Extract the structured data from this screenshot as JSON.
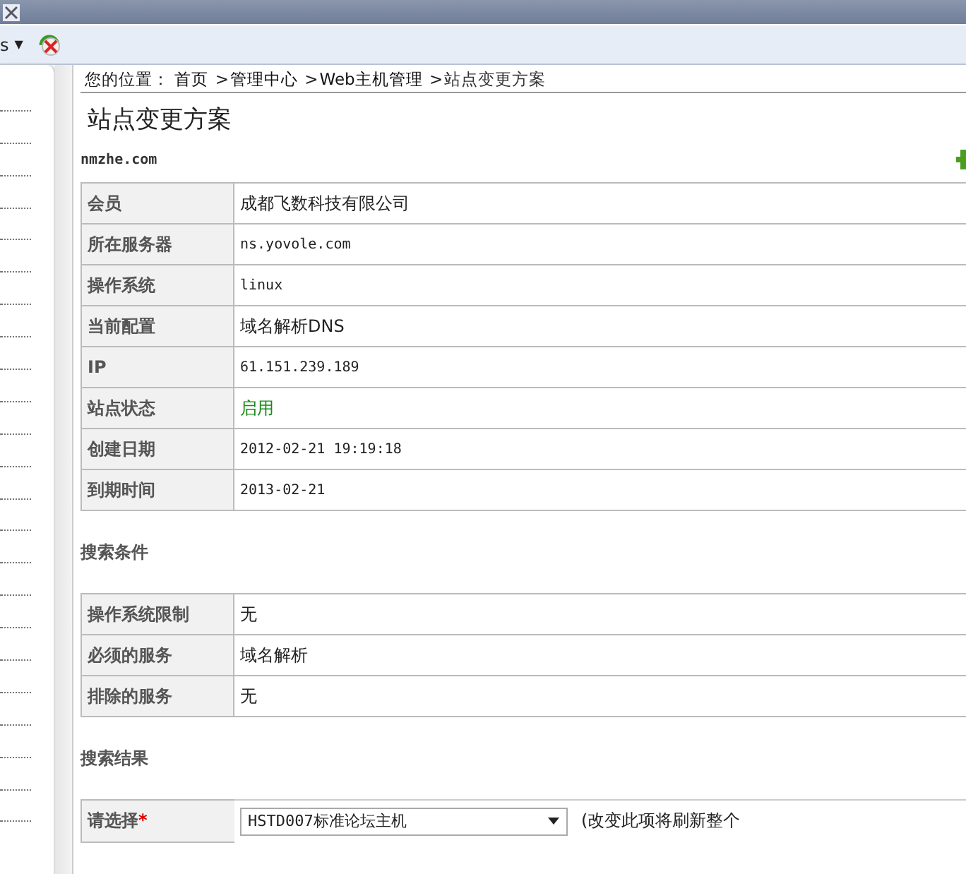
{
  "toolbar": {
    "menu_label": "s",
    "menu_caret": "▼"
  },
  "breadcrumb": {
    "prefix": "您的位置：",
    "separator": ">",
    "items": [
      {
        "label": "首页"
      },
      {
        "label": "管理中心"
      },
      {
        "label": "Web主机管理"
      },
      {
        "label": "站点变更方案"
      }
    ]
  },
  "page_title": "站点变更方案",
  "domain": "nmzhe.com",
  "site_info": [
    {
      "label": "会员",
      "value": "成都飞数科技有限公司",
      "kind": "text"
    },
    {
      "label": "所在服务器",
      "value": "ns.yovole.com",
      "kind": "mono"
    },
    {
      "label": "操作系统",
      "value": "linux",
      "kind": "mono"
    },
    {
      "label": "当前配置",
      "value": "域名解析DNS",
      "kind": "text"
    },
    {
      "label": "IP",
      "value": "61.151.239.189",
      "kind": "mono"
    },
    {
      "label": "站点状态",
      "value": "启用",
      "kind": "status"
    },
    {
      "label": "创建日期",
      "value": "2012-02-21 19:19:18",
      "kind": "mono"
    },
    {
      "label": "到期时间",
      "value": "2013-02-21",
      "kind": "mono"
    }
  ],
  "search_conditions": {
    "heading": "搜索条件",
    "rows": [
      {
        "label": "操作系统限制",
        "value": "无"
      },
      {
        "label": "必须的服务",
        "value": "域名解析"
      },
      {
        "label": "排除的服务",
        "value": "无"
      }
    ]
  },
  "search_results": {
    "heading": "搜索结果",
    "label": "请选择",
    "required_mark": "*",
    "select_value": "HSTD007标准论坛主机",
    "hint": "(改变此项将刷新整个"
  }
}
